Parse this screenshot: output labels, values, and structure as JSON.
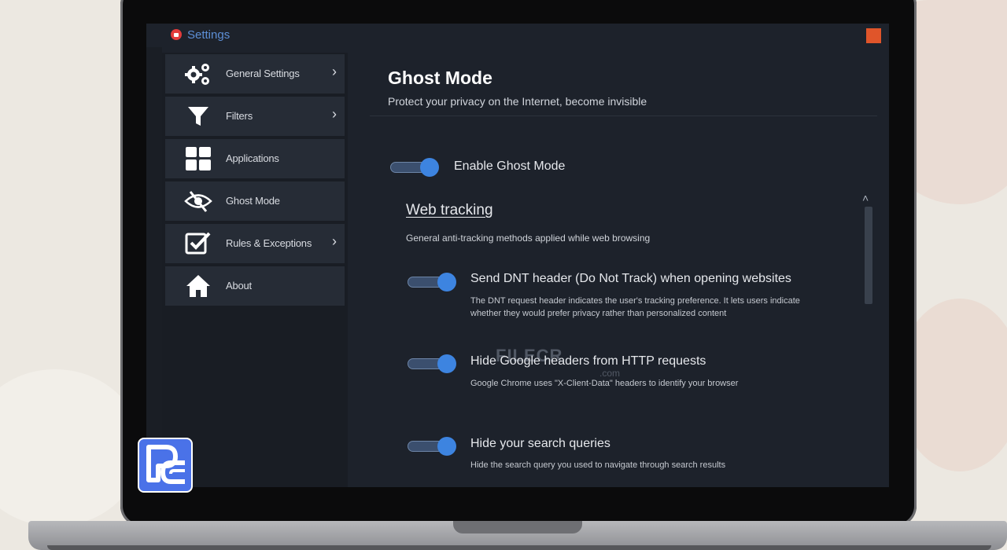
{
  "window": {
    "title": "Settings"
  },
  "sidebar": {
    "items": [
      {
        "label": "General Settings",
        "icon": "gears-icon",
        "has_chevron": true
      },
      {
        "label": "Filters",
        "icon": "filter-icon",
        "has_chevron": true
      },
      {
        "label": "Applications",
        "icon": "grid-icon",
        "has_chevron": false
      },
      {
        "label": "Ghost Mode",
        "icon": "eye-slash-icon",
        "has_chevron": false
      },
      {
        "label": "Rules & Exceptions",
        "icon": "checkbox-icon",
        "has_chevron": true
      },
      {
        "label": "About",
        "icon": "home-icon",
        "has_chevron": false
      }
    ]
  },
  "main": {
    "title": "Ghost Mode",
    "subtitle": "Protect your privacy on the Internet, become invisible",
    "enable_label": "Enable Ghost Mode",
    "enable_on": true,
    "section": {
      "title": "Web tracking",
      "description": "General anti-tracking methods applied while web browsing"
    },
    "options": [
      {
        "title": "Send DNT header (Do Not Track) when opening websites",
        "description": "The DNT request header indicates the user's tracking preference. It lets users indicate whether they would prefer privacy rather than personalized content",
        "on": true
      },
      {
        "title": "Hide Google headers from HTTP requests",
        "description": "Google Chrome uses \"X-Client-Data\" headers to identify your browser",
        "on": true
      },
      {
        "title": "Hide your search queries",
        "description": "Hide the search query you used to navigate through search results",
        "on": true
      }
    ]
  },
  "watermark": {
    "text": "FILECR",
    "suffix": ".com"
  },
  "colors": {
    "accent": "#3d84e0",
    "close": "#e0552a",
    "background": "#1d222b"
  }
}
